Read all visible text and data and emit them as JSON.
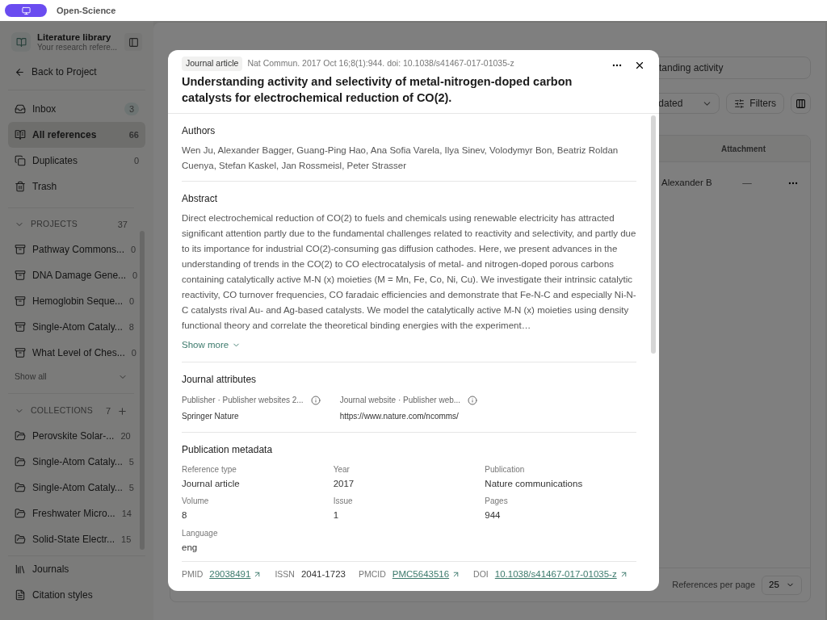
{
  "app": {
    "name": "Open-Science"
  },
  "sidebar": {
    "title": "Literature library",
    "subtitle": "Your research refere...",
    "back": "Back to Project",
    "nav": [
      {
        "kind": "inbox",
        "label": "Inbox",
        "count": "3",
        "selected": false
      },
      {
        "kind": "references",
        "label": "All references",
        "count": "66",
        "selected": true
      },
      {
        "kind": "duplicates",
        "label": "Duplicates",
        "count": "0",
        "selected": false
      },
      {
        "kind": "trash",
        "label": "Trash",
        "selected": false
      }
    ],
    "projects": {
      "label": "PROJECTS",
      "count": "37",
      "expanded": true,
      "show_all": "Show all",
      "items": [
        {
          "label": "Pathway Commons...",
          "count": "0"
        },
        {
          "label": "DNA Damage Gene...",
          "count": "0"
        },
        {
          "label": "Hemoglobin Seque...",
          "count": "0"
        },
        {
          "label": "Single-Atom Cataly...",
          "count": "8"
        },
        {
          "label": "What Level of Ches...",
          "count": "0"
        }
      ]
    },
    "collections": {
      "label": "COLLECTIONS",
      "count": "7",
      "expanded": true,
      "items": [
        {
          "label": "Perovskite Solar-...",
          "count": "20"
        },
        {
          "label": "Single-Atom Cataly...",
          "count": "5"
        },
        {
          "label": "Single-Atom Cataly...",
          "count": "5"
        },
        {
          "label": "Freshwater Micro...",
          "count": "14"
        },
        {
          "label": "Solid-State Electr...",
          "count": "15"
        }
      ]
    },
    "footer": [
      {
        "kind": "journals",
        "label": "Journals"
      },
      {
        "kind": "citation",
        "label": "Citation styles"
      }
    ]
  },
  "main": {
    "search": {
      "value": "tanding activity"
    },
    "sort": {
      "value": "dated"
    },
    "filters": "Filters",
    "table": {
      "columns": [
        "Attachment"
      ],
      "rows": [
        {
          "author": "Alexander B",
          "attachment": "—"
        }
      ]
    },
    "per_page": {
      "label": "References per page",
      "value": "25"
    }
  },
  "dialog": {
    "type": "Journal article",
    "citation": "Nat Commun. 2017 Oct 16;8(1):944. doi: 10.1038/s41467-017-01035-z",
    "title": "Understanding activity and selectivity of metal-nitrogen-doped carbon catalysts for electrochemical reduction of CO(2).",
    "authors": {
      "label": "Authors",
      "text": "Wen Ju, Alexander Bagger, Guang-Ping Hao, Ana Sofia Varela, Ilya Sinev, Volodymyr Bon, Beatriz Roldan Cuenya, Stefan Kaskel, Jan Rossmeisl, Peter Strasser"
    },
    "abstract": {
      "label": "Abstract",
      "text": "Direct electrochemical reduction of CO(2) to fuels and chemicals using renewable electricity has attracted significant attention partly due to the fundamental challenges related to reactivity and selectivity, and partly due to its importance for industrial CO(2)-consuming gas diffusion cathodes. Here, we present advances in the understanding of trends in the CO(2) to CO electrocatalysis of metal- and nitrogen-doped porous carbons containing catalytically active M-N (x) moieties (M = Mn, Fe, Co, Ni, Cu). We investigate their intrinsic catalytic reactivity, CO turnover frequencies, CO faradaic efficiencies and demonstrate that Fe-N-C and especially Ni-N-C catalysts rival Au- and Ag-based catalysts. We model the catalytically active M-N (x) moieties using density functional theory and correlate the theoretical binding energies with the experiment…",
      "show_more": "Show more"
    },
    "journal": {
      "label": "Journal attributes",
      "fields": [
        {
          "label": "Publisher · Publisher websites 2...",
          "value": "Springer Nature"
        },
        {
          "label": "Journal website · Publisher web...",
          "value": "https://www.nature.com/ncomms/"
        }
      ]
    },
    "metadata": {
      "label": "Publication metadata",
      "fields": [
        {
          "label": "Reference type",
          "value": "Journal article"
        },
        {
          "label": "Year",
          "value": "2017"
        },
        {
          "label": "Publication",
          "value": "Nature communications"
        },
        {
          "label": "Volume",
          "value": "8"
        },
        {
          "label": "Issue",
          "value": "1"
        },
        {
          "label": "Pages",
          "value": "944"
        },
        {
          "label": "Language",
          "value": "eng"
        }
      ]
    },
    "identifiers": [
      {
        "kind": "link",
        "label": "PMID",
        "value": "29038491"
      },
      {
        "kind": "text",
        "label": "ISSN",
        "value": "2041-1723"
      },
      {
        "kind": "link",
        "label": "PMCID",
        "value": "PMC5643516"
      },
      {
        "kind": "link",
        "label": "DOI",
        "value": "10.1038/s41467-017-01035-z"
      }
    ]
  }
}
